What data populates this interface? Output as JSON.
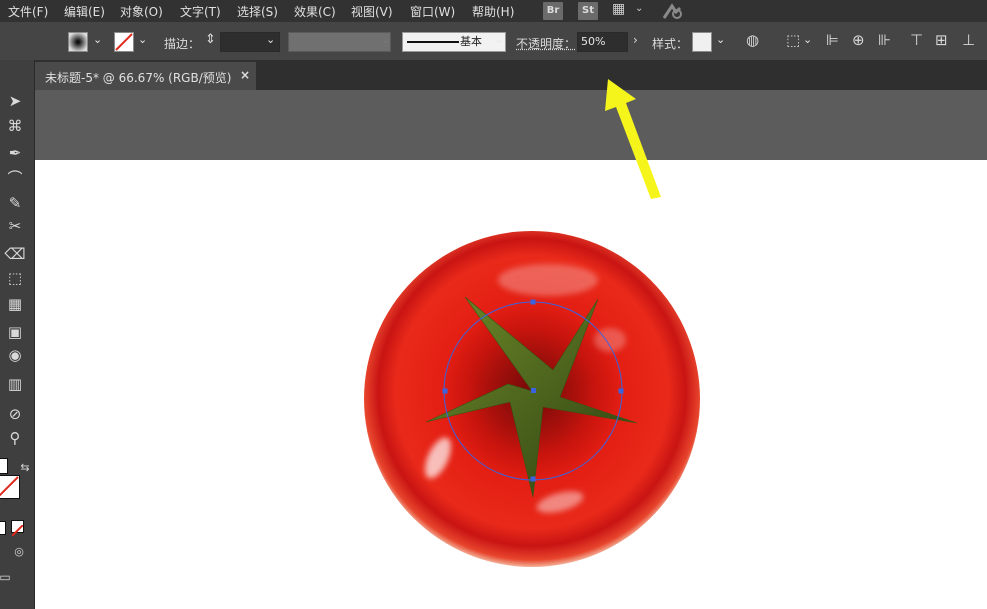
{
  "menu": {
    "items": [
      {
        "id": "file",
        "label": "文件(F)"
      },
      {
        "id": "edit",
        "label": "编辑(E)"
      },
      {
        "id": "object",
        "label": "对象(O)"
      },
      {
        "id": "type",
        "label": "文字(T)"
      },
      {
        "id": "select",
        "label": "选择(S)"
      },
      {
        "id": "effect",
        "label": "效果(C)"
      },
      {
        "id": "view",
        "label": "视图(V)"
      },
      {
        "id": "window",
        "label": "窗口(W)"
      },
      {
        "id": "help",
        "label": "帮助(H)"
      }
    ],
    "bridge_label": "Br",
    "stock_label": "St"
  },
  "control": {
    "stroke_label": "描边：",
    "brush_label": "基本",
    "opacity_label": "不透明度：",
    "opacity_value": "50%",
    "style_label": "样式："
  },
  "document": {
    "tab_title": "未标题-5* @ 66.67% (RGB/预览)",
    "close_glyph": "×"
  },
  "icons": [
    "menu-chevron-icon",
    "layout-icon",
    "sync-icon",
    "fill-swatch-icon",
    "stroke-swatch-icon",
    "recolor-icon",
    "transform-icon",
    "align-icon",
    "selection-tool-icon",
    "direct-selection-icon",
    "pen-icon",
    "curvature-icon",
    "brush-icon",
    "scissors-icon",
    "eraser-icon",
    "free-transform-icon",
    "perspective-icon",
    "gradient-icon",
    "shape-builder-icon",
    "graph-icon",
    "eyedropper-icon",
    "zoom-icon",
    "swap-icon"
  ],
  "colors": {
    "tomato_red": "#e8251b",
    "stem_green": "#4c6b1c",
    "selection_blue": "#3b63e0",
    "arrow_yellow": "#f5f51c",
    "ui_dark": "#323232",
    "ui_mid": "#454545"
  }
}
